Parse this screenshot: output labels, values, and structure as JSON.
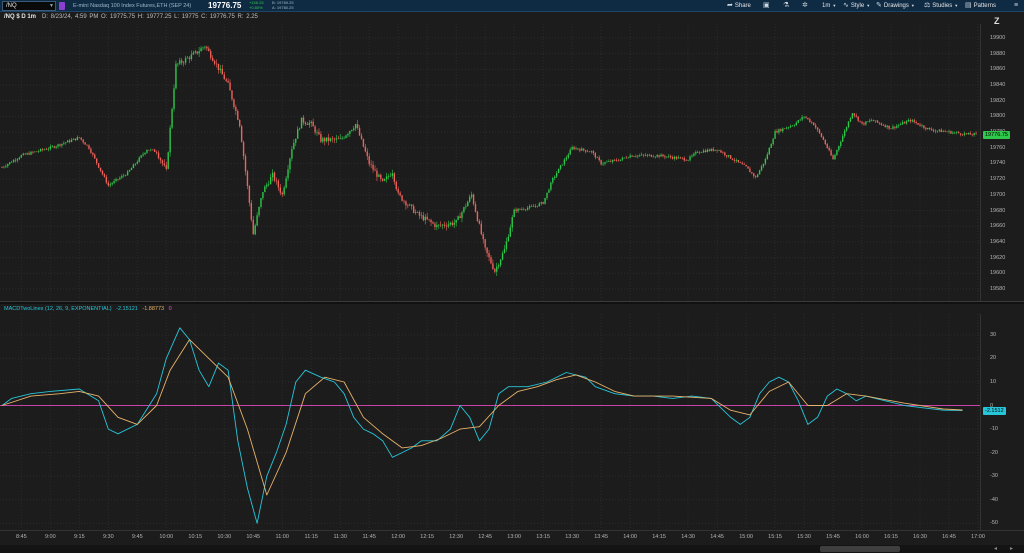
{
  "toolbar": {
    "symbol": "/NQ",
    "instrument_description": "E-mini Nasdaq 100 Index Futures,ETH (SEP 24)",
    "last_price": "19776.75",
    "net_change_1": "+156.25",
    "net_change_2": "+0.80%",
    "bid": "B: 19769.25",
    "ask": "A: 19780.25",
    "share_label": "Share",
    "aggregation": "1m",
    "style_label": "Style",
    "drawings_label": "Drawings",
    "studies_label": "Studies",
    "patterns_label": "Patterns"
  },
  "info_line": {
    "symbol": "/NQ $ D 1m",
    "date": "D: 8/23/24, 4:59 PM",
    "open": "O: 19775.75",
    "high": "H: 19777.25",
    "low": "L: 19775",
    "close": "C: 19776.75",
    "range": "R: 2.25"
  },
  "study": {
    "name": "MACDTwoLines (12, 26, 9, EXPONENTIAL)",
    "value1": "-2.15121",
    "value2": "-1.88773",
    "value3": "0",
    "badge_value": "-2.1512",
    "colors": {
      "macd": "#26c6da",
      "signal": "#e8b26a",
      "zero": "#ff4fd8"
    }
  },
  "price_badge": "19776.75",
  "price_axis_labels": [
    "19900",
    "19880",
    "19860",
    "19840",
    "19820",
    "19800",
    "19780",
    "19760",
    "19740",
    "19720",
    "19700",
    "19680",
    "19660",
    "19640",
    "19620",
    "19600",
    "19580"
  ],
  "macd_axis_labels": [
    "30",
    "20",
    "10",
    "0",
    "-10",
    "-20",
    "-30",
    "-40",
    "-50"
  ],
  "time_axis_labels": [
    "8:45",
    "9:00",
    "9:15",
    "9:30",
    "9:45",
    "10:00",
    "10:15",
    "10:30",
    "10:45",
    "11:00",
    "11:15",
    "11:30",
    "11:45",
    "12:00",
    "12:15",
    "12:30",
    "12:45",
    "13:00",
    "13:15",
    "13:30",
    "13:45",
    "14:00",
    "14:15",
    "14:30",
    "14:45",
    "15:00",
    "15:15",
    "15:30",
    "15:45",
    "16:00",
    "16:15",
    "16:30",
    "16:45",
    "17:00"
  ],
  "colors": {
    "up": "#2ec84a",
    "down": "#f0625a",
    "accent": "#26c6da",
    "badge_price": "#2ec84a"
  },
  "chart_data": [
    {
      "type": "candlestick",
      "ylim": [
        19580,
        19910
      ],
      "x_range": [
        "8:35",
        "17:00"
      ],
      "close_path": [
        [
          "8:35",
          19735
        ],
        [
          "8:45",
          19750
        ],
        [
          "9:00",
          19760
        ],
        [
          "9:15",
          19773
        ],
        [
          "9:20",
          19760
        ],
        [
          "9:30",
          19712
        ],
        [
          "9:40",
          19728
        ],
        [
          "9:50",
          19758
        ],
        [
          "9:55",
          19755
        ],
        [
          "10:00",
          19730
        ],
        [
          "10:05",
          19865
        ],
        [
          "10:15",
          19880
        ],
        [
          "10:20",
          19890
        ],
        [
          "10:25",
          19870
        ],
        [
          "10:32",
          19840
        ],
        [
          "10:38",
          19790
        ],
        [
          "10:45",
          19650
        ],
        [
          "10:50",
          19705
        ],
        [
          "10:55",
          19725
        ],
        [
          "11:00",
          19700
        ],
        [
          "11:05",
          19760
        ],
        [
          "11:10",
          19795
        ],
        [
          "11:15",
          19790
        ],
        [
          "11:20",
          19770
        ],
        [
          "11:30",
          19770
        ],
        [
          "11:38",
          19790
        ],
        [
          "11:45",
          19740
        ],
        [
          "11:52",
          19715
        ],
        [
          "11:57",
          19730
        ],
        [
          "12:00",
          19700
        ],
        [
          "12:10",
          19675
        ],
        [
          "12:20",
          19660
        ],
        [
          "12:30",
          19665
        ],
        [
          "12:38",
          19700
        ],
        [
          "12:45",
          19630
        ],
        [
          "12:50",
          19603
        ],
        [
          "12:55",
          19630
        ],
        [
          "13:00",
          19680
        ],
        [
          "13:10",
          19685
        ],
        [
          "13:15",
          19690
        ],
        [
          "13:20",
          19720
        ],
        [
          "13:30",
          19760
        ],
        [
          "13:40",
          19755
        ],
        [
          "13:45",
          19740
        ],
        [
          "13:55",
          19745
        ],
        [
          "14:00",
          19750
        ],
        [
          "14:15",
          19750
        ],
        [
          "14:30",
          19745
        ],
        [
          "14:35",
          19755
        ],
        [
          "14:45",
          19758
        ],
        [
          "15:00",
          19735
        ],
        [
          "15:05",
          19722
        ],
        [
          "15:10",
          19745
        ],
        [
          "15:15",
          19780
        ],
        [
          "15:25",
          19790
        ],
        [
          "15:30",
          19800
        ],
        [
          "15:35",
          19790
        ],
        [
          "15:40",
          19770
        ],
        [
          "15:45",
          19745
        ],
        [
          "15:50",
          19775
        ],
        [
          "15:55",
          19805
        ],
        [
          "16:00",
          19790
        ],
        [
          "16:05",
          19795
        ],
        [
          "16:15",
          19785
        ],
        [
          "16:25",
          19795
        ],
        [
          "16:35",
          19783
        ],
        [
          "16:45",
          19780
        ],
        [
          "16:55",
          19777
        ]
      ]
    },
    {
      "type": "line",
      "title": "MACDTwoLines (12, 26, 9, EXPONENTIAL)",
      "ylim": [
        -52,
        38
      ],
      "series": [
        {
          "name": "MACD",
          "points": [
            [
              "8:35",
              0
            ],
            [
              "8:40",
              3
            ],
            [
              "8:50",
              5
            ],
            [
              "9:00",
              6
            ],
            [
              "9:15",
              7
            ],
            [
              "9:25",
              2
            ],
            [
              "9:30",
              -10
            ],
            [
              "9:35",
              -12
            ],
            [
              "9:45",
              -8
            ],
            [
              "9:55",
              5
            ],
            [
              "10:00",
              20
            ],
            [
              "10:07",
              33
            ],
            [
              "10:12",
              28
            ],
            [
              "10:17",
              15
            ],
            [
              "10:22",
              8
            ],
            [
              "10:27",
              18
            ],
            [
              "10:32",
              15
            ],
            [
              "10:37",
              -15
            ],
            [
              "10:42",
              -35
            ],
            [
              "10:47",
              -50
            ],
            [
              "10:52",
              -30
            ],
            [
              "10:57",
              -20
            ],
            [
              "11:02",
              -8
            ],
            [
              "11:07",
              10
            ],
            [
              "11:12",
              15
            ],
            [
              "11:20",
              12
            ],
            [
              "11:27",
              10
            ],
            [
              "11:32",
              5
            ],
            [
              "11:37",
              -5
            ],
            [
              "11:42",
              -10
            ],
            [
              "11:47",
              -12
            ],
            [
              "11:52",
              -15
            ],
            [
              "11:57",
              -22
            ],
            [
              "12:02",
              -20
            ],
            [
              "12:07",
              -18
            ],
            [
              "12:12",
              -15
            ],
            [
              "12:20",
              -15
            ],
            [
              "12:27",
              -10
            ],
            [
              "12:32",
              0
            ],
            [
              "12:37",
              -5
            ],
            [
              "12:42",
              -15
            ],
            [
              "12:47",
              -10
            ],
            [
              "12:52",
              5
            ],
            [
              "12:57",
              8
            ],
            [
              "13:07",
              8
            ],
            [
              "13:17",
              10
            ],
            [
              "13:27",
              14
            ],
            [
              "13:37",
              12
            ],
            [
              "13:42",
              8
            ],
            [
              "13:52",
              5
            ],
            [
              "14:02",
              4
            ],
            [
              "14:12",
              4
            ],
            [
              "14:22",
              3
            ],
            [
              "14:32",
              4
            ],
            [
              "14:42",
              3
            ],
            [
              "14:52",
              -5
            ],
            [
              "14:57",
              -8
            ],
            [
              "15:02",
              -5
            ],
            [
              "15:07",
              5
            ],
            [
              "15:12",
              10
            ],
            [
              "15:17",
              12
            ],
            [
              "15:22",
              10
            ],
            [
              "15:27",
              2
            ],
            [
              "15:32",
              -8
            ],
            [
              "15:37",
              -5
            ],
            [
              "15:42",
              4
            ],
            [
              "15:47",
              7
            ],
            [
              "15:52",
              5
            ],
            [
              "15:57",
              2
            ],
            [
              "16:02",
              4
            ],
            [
              "16:12",
              2
            ],
            [
              "16:22",
              0
            ],
            [
              "16:32",
              -1
            ],
            [
              "16:42",
              -2
            ],
            [
              "16:52",
              -2.15
            ]
          ]
        },
        {
          "name": "Signal",
          "points": [
            [
              "8:35",
              0
            ],
            [
              "8:50",
              4
            ],
            [
              "9:05",
              5
            ],
            [
              "9:15",
              6
            ],
            [
              "9:25",
              4
            ],
            [
              "9:35",
              -5
            ],
            [
              "9:45",
              -8
            ],
            [
              "9:55",
              0
            ],
            [
              "10:02",
              15
            ],
            [
              "10:12",
              28
            ],
            [
              "10:22",
              20
            ],
            [
              "10:32",
              12
            ],
            [
              "10:42",
              -10
            ],
            [
              "10:52",
              -38
            ],
            [
              "11:02",
              -20
            ],
            [
              "11:12",
              5
            ],
            [
              "11:22",
              12
            ],
            [
              "11:32",
              10
            ],
            [
              "11:42",
              -5
            ],
            [
              "11:52",
              -12
            ],
            [
              "12:02",
              -18
            ],
            [
              "12:12",
              -17
            ],
            [
              "12:22",
              -14
            ],
            [
              "12:32",
              -10
            ],
            [
              "12:42",
              -9
            ],
            [
              "12:52",
              0
            ],
            [
              "13:02",
              6
            ],
            [
              "13:12",
              8
            ],
            [
              "13:22",
              11
            ],
            [
              "13:32",
              13
            ],
            [
              "13:42",
              10
            ],
            [
              "13:52",
              6
            ],
            [
              "14:02",
              4
            ],
            [
              "14:22",
              4
            ],
            [
              "14:42",
              3
            ],
            [
              "14:52",
              -2
            ],
            [
              "15:02",
              -4
            ],
            [
              "15:12",
              6
            ],
            [
              "15:22",
              10
            ],
            [
              "15:32",
              0
            ],
            [
              "15:42",
              0
            ],
            [
              "15:52",
              5
            ],
            [
              "16:02",
              4
            ],
            [
              "16:22",
              1
            ],
            [
              "16:42",
              -1.5
            ],
            [
              "16:52",
              -1.89
            ]
          ]
        }
      ]
    }
  ]
}
